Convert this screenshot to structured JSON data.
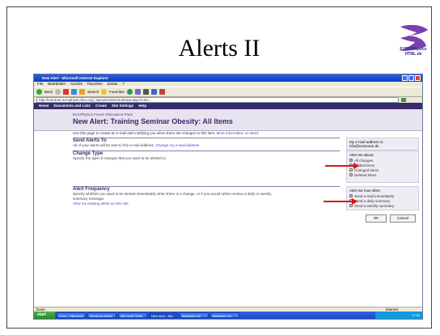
{
  "slide": {
    "title": "Alerts II"
  },
  "logo": {
    "text_line1": "EUROPhysics",
    "text_line2": "HTML.de"
  },
  "browser": {
    "window_title": "New Alert - Microsoft Internet Explorer",
    "menu": [
      "File",
      "Bearbeiten",
      "Ansicht",
      "Favoriten",
      "Extras",
      "?"
    ],
    "back": "Back",
    "search": "Search",
    "favorites": "Favorites",
    "address": "http://extranet.europhysicsfun.org/_layouts/1031/SubNew.aspx?List=...",
    "links": "Links"
  },
  "sharepoint": {
    "topnav": [
      "Home",
      "Documents and Lists",
      "Create",
      "Site Settings",
      "Help"
    ],
    "site_name": "EuroPhysics Forum Discussion Pane",
    "page_title": "New Alert: Training Seminar Obesity: All Items",
    "intro": "Use this page to create an e-mail alert notifying you when there are changes to this item.",
    "intro_link": "More information on alerts.",
    "send_alerts_to": {
      "heading": "Send Alerts To",
      "desc": "All of your alerts will be sent to this e-mail address.",
      "link": "Change my e-mail address",
      "label": "My e-mail address is:",
      "email": "info@someone.de"
    },
    "change_type": {
      "heading": "Change Type",
      "desc": "Specify the type of changes that you want to be alerted to.",
      "label": "Alert me about:",
      "options": [
        "All changes",
        "Added items",
        "Changed items",
        "Deleted items"
      ],
      "selected": 0
    },
    "alert_frequency": {
      "heading": "Alert Frequency",
      "desc": "Specify whether you want to be alerted immediately when there is a change, or if you would rather receive a daily or weekly summary message.",
      "link": "View my existing alerts on this site.",
      "label": "Alert me how often:",
      "options": [
        "Send e-mail immediately",
        "Send a daily summary",
        "Send a weekly summary"
      ],
      "selected": 0
    },
    "ok": "OK",
    "cancel": "Cancel"
  },
  "status": {
    "left": "Done",
    "right": "Internet"
  },
  "taskbar": {
    "start": "start",
    "tasks": [
      "Inbox - Microsoft",
      "Windows Media",
      "Microsoft Outlo",
      "New Alert - Mic",
      "Message ext",
      "Message ext"
    ],
    "clock": "17:55"
  },
  "colors": {
    "arrow": "#e01010",
    "sp_nav": "#3b2a6a",
    "title_bar": "#0a3cc0"
  }
}
